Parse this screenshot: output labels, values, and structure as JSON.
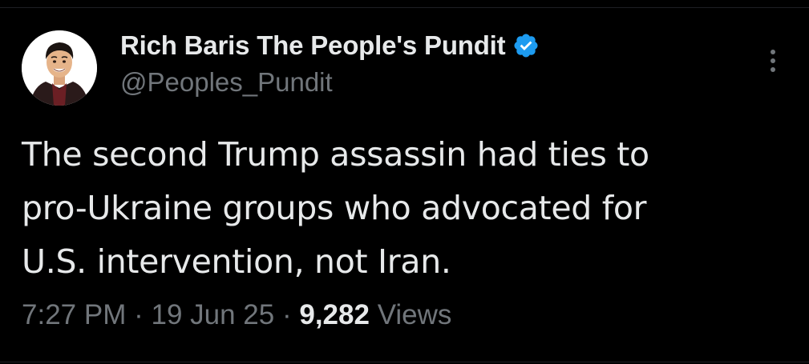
{
  "tweet": {
    "author": {
      "display_name": "Rich Baris The People's Pundit",
      "handle": "@Peoples_Pundit",
      "verified": true,
      "verified_icon": "verified-badge-icon",
      "avatar_icon": "cartoon-portrait-avatar"
    },
    "text": "The second Trump assassin had ties to\npro-Ukraine groups who advocated for\nU.S. intervention, not Iran.",
    "meta": {
      "time": "7:27 PM",
      "separator": "·",
      "date": "19 Jun 25",
      "views_count": "9,282",
      "views_label": "Views"
    },
    "more_icon": "more-options-icon"
  },
  "colors": {
    "background": "#000000",
    "primary_text": "#e7e9ea",
    "secondary_text": "#71767b",
    "verified_blue": "#1d9bf0"
  }
}
